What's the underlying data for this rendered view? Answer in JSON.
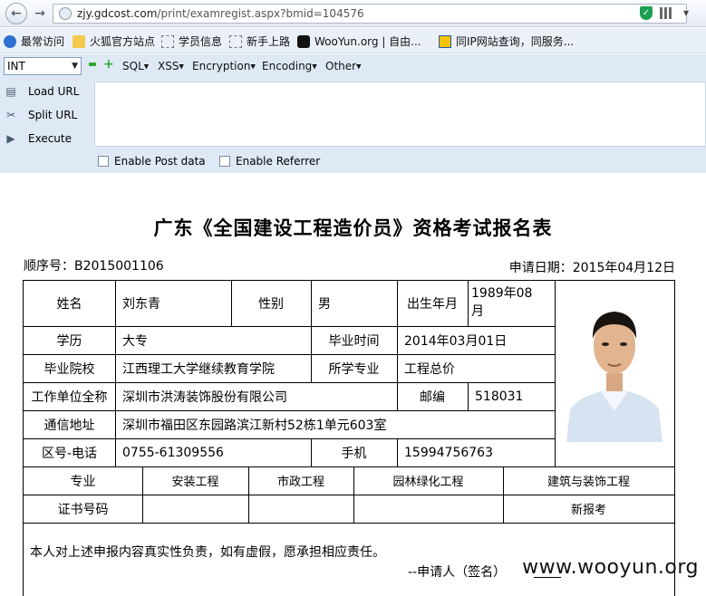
{
  "browser": {
    "url_host": "zjy.gdcost.com",
    "url_path": "/print/examregist.aspx?bmid=104576"
  },
  "bookmarks": [
    {
      "label": "最常访问",
      "icon": "search-icon"
    },
    {
      "label": "火狐官方站点",
      "icon": "folder-icon"
    },
    {
      "label": "学员信息",
      "icon": "page-icon"
    },
    {
      "label": "新手上路",
      "icon": "page-icon"
    },
    {
      "label": "WooYun.org | 自由...",
      "icon": "wooyun-icon"
    },
    {
      "label": "同IP网站查询，同服务...",
      "icon": "card-icon"
    }
  ],
  "hackbar": {
    "type_select": "INT",
    "menus": [
      "SQL",
      "XSS",
      "Encryption",
      "Encoding",
      "Other"
    ],
    "load_url": "Load URL",
    "split_url": "Split URL",
    "execute": "Execute",
    "post_label": "Enable Post data",
    "referrer_label": "Enable Referrer",
    "textarea_value": ""
  },
  "page": {
    "title": "广东《全国建设工程造价员》资格考试报名表",
    "seq_label": "顺序号：",
    "seq_value": "B2015001106",
    "date_label": "申请日期：",
    "date_value": "2015年04月12日"
  },
  "form": {
    "name_label": "姓名",
    "name": "刘东青",
    "gender_label": "性别",
    "gender": "男",
    "birth_label": "出生年月",
    "birth_line1": "1989年08",
    "birth_line2": "月",
    "edu_label": "学历",
    "edu": "大专",
    "grad_time_label": "毕业时间",
    "grad_time": "2014年03月01日",
    "school_label": "毕业院校",
    "school": "江西理工大学继续教育学院",
    "major_label": "所学专业",
    "major": "工程总价",
    "employer_label": "工作单位全称",
    "employer": "深圳市洪涛装饰股份有限公司",
    "zip_label": "邮编",
    "zip": "518031",
    "address_label": "通信地址",
    "address": "深圳市福田区东园路滨江新村52栋1单元603室",
    "phone_label": "区号-电话",
    "phone": "0755-61309556",
    "mobile_label": "手机",
    "mobile": "15994756763",
    "specialty_label": "专业",
    "specialties": [
      "安装工程",
      "市政工程",
      "园林绿化工程",
      "建筑与装饰工程"
    ],
    "cert_label": "证书号码",
    "cert_values": [
      "",
      "",
      "",
      "新报考"
    ],
    "declaration": "本人对上述申报内容真实性负责，如有虚假，愿承担相应责任。",
    "signer": "--申请人（签名）"
  },
  "watermark": "www.wooyun.org"
}
